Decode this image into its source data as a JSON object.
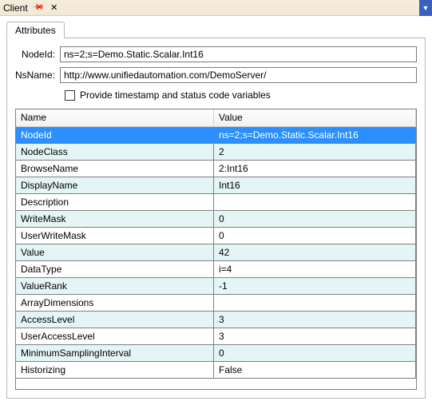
{
  "titlebar": {
    "title": "Client"
  },
  "tabs": {
    "attributes_label": "Attributes"
  },
  "form": {
    "nodeid_label": "NodeId:",
    "nodeid_value": "ns=2;s=Demo.Static.Scalar.Int16",
    "nsname_label": "NsName:",
    "nsname_value": "http://www.unifiedautomation.com/DemoServer/",
    "check_label": "Provide timestamp and status code variables"
  },
  "table": {
    "name_header": "Name",
    "value_header": "Value",
    "rows": [
      {
        "name": "NodeId",
        "value": "ns=2;s=Demo.Static.Scalar.Int16",
        "selected": true
      },
      {
        "name": "NodeClass",
        "value": "2"
      },
      {
        "name": "BrowseName",
        "value": "2:Int16"
      },
      {
        "name": "DisplayName",
        "value": "Int16"
      },
      {
        "name": "Description",
        "value": ""
      },
      {
        "name": "WriteMask",
        "value": "0"
      },
      {
        "name": "UserWriteMask",
        "value": "0"
      },
      {
        "name": "Value",
        "value": "42"
      },
      {
        "name": "DataType",
        "value": "i=4"
      },
      {
        "name": "ValueRank",
        "value": "-1"
      },
      {
        "name": "ArrayDimensions",
        "value": ""
      },
      {
        "name": "AccessLevel",
        "value": "3"
      },
      {
        "name": "UserAccessLevel",
        "value": "3"
      },
      {
        "name": "MinimumSamplingInterval",
        "value": "0"
      },
      {
        "name": "Historizing",
        "value": "False"
      }
    ]
  }
}
